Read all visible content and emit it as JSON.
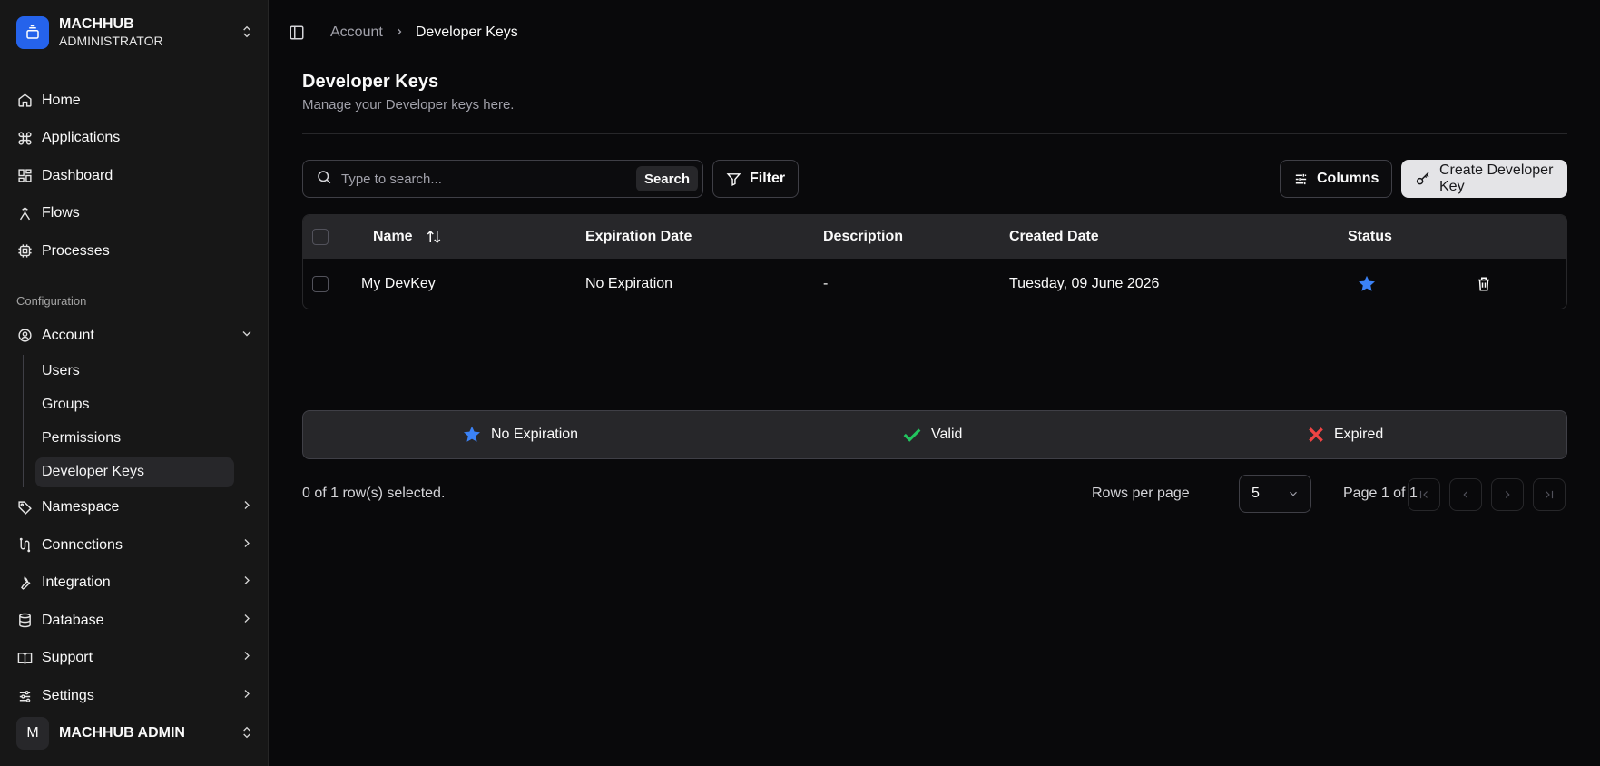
{
  "brand": {
    "name": "MACHHUB",
    "role": "ADMINISTRATOR"
  },
  "nav": {
    "items": [
      {
        "label": "Home",
        "icon": "home-icon"
      },
      {
        "label": "Applications",
        "icon": "command-icon"
      },
      {
        "label": "Dashboard",
        "icon": "dashboard-icon"
      },
      {
        "label": "Flows",
        "icon": "flows-icon"
      },
      {
        "label": "Processes",
        "icon": "chip-icon"
      }
    ],
    "section_label": "Configuration",
    "account": {
      "label": "Account",
      "children": [
        "Users",
        "Groups",
        "Permissions",
        "Developer Keys"
      ],
      "active_child": "Developer Keys"
    },
    "groups": [
      {
        "label": "Namespace",
        "icon": "tag-icon"
      },
      {
        "label": "Connections",
        "icon": "connections-icon"
      },
      {
        "label": "Integration",
        "icon": "wrench-icon"
      },
      {
        "label": "Database",
        "icon": "database-icon"
      },
      {
        "label": "Support",
        "icon": "book-icon"
      },
      {
        "label": "Settings",
        "icon": "settings-icon"
      }
    ]
  },
  "user": {
    "initial": "M",
    "name": "MACHHUB ADMIN"
  },
  "breadcrumb": {
    "parent": "Account",
    "current": "Developer Keys"
  },
  "page": {
    "title": "Developer Keys",
    "subtitle": "Manage your Developer keys here."
  },
  "toolbar": {
    "search_placeholder": "Type to search...",
    "search_label": "Search",
    "filter_label": "Filter",
    "columns_label": "Columns",
    "create_label": "Create Developer Key"
  },
  "table": {
    "headers": {
      "name": "Name",
      "expiration": "Expiration Date",
      "description": "Description",
      "created": "Created Date",
      "status": "Status"
    },
    "rows": [
      {
        "name": "My DevKey",
        "expiration": "No Expiration",
        "description": "-",
        "created": "Tuesday, 09 June 2026",
        "status": "no-expiration"
      }
    ]
  },
  "legend": {
    "no_expiration": "No Expiration",
    "valid": "Valid",
    "expired": "Expired"
  },
  "colors": {
    "accent": "#2563eb",
    "star": "#3b82f6",
    "valid": "#22c55e",
    "expired": "#ef4444"
  },
  "footer": {
    "selection": "0 of 1 row(s) selected.",
    "rows_per_page_label": "Rows per page",
    "rows_per_page_value": "5",
    "page_info": "Page 1 of 1"
  }
}
